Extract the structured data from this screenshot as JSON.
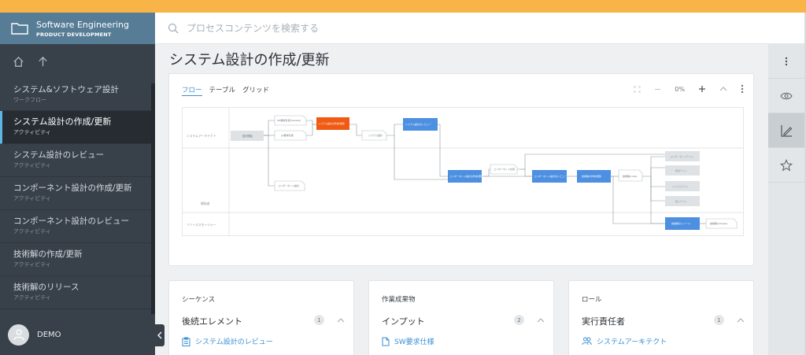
{
  "header": {
    "project_title": "Software Engineering",
    "project_subtitle": "PRODUCT DEVELOPMENT",
    "search_placeholder": "プロセスコンテンツを検索する"
  },
  "sidebar": {
    "items": [
      {
        "name": "システム&ソフトウェア設計",
        "type": "ワークフロー",
        "active": false
      },
      {
        "name": "システム設計の作成/更新",
        "type": "アクティビティ",
        "active": true
      },
      {
        "name": "システム設計のレビュー",
        "type": "アクティビティ",
        "active": false
      },
      {
        "name": "コンポーネント設計の作成/更新",
        "type": "アクティビティ",
        "active": false
      },
      {
        "name": "コンポーネント設計のレビュー",
        "type": "アクティビティ",
        "active": false
      },
      {
        "name": "技術解の作成/更新",
        "type": "アクティビティ",
        "active": false
      },
      {
        "name": "技術解のリリース",
        "type": "アクティビティ",
        "active": false
      }
    ],
    "user": "DEMO"
  },
  "page": {
    "title": "システム設計の作成/更新"
  },
  "flow_card": {
    "tabs": [
      "フロー",
      "テーブル",
      "グリッド"
    ],
    "zoom": "0%"
  },
  "diagram": {
    "lanes": [
      "システムアーキテクト",
      "開発者",
      "リリースマネージャー"
    ],
    "nodes": [
      {
        "id": "start",
        "label": "設計開始",
        "kind": "gray"
      },
      {
        "id": "d1",
        "label": "SW要求仕様(release)",
        "kind": "doc"
      },
      {
        "id": "d2",
        "label": "go要求仕様",
        "kind": "doc"
      },
      {
        "id": "a1",
        "label": "システム設計の作成/更新",
        "kind": "current"
      },
      {
        "id": "d3",
        "label": "システム設計",
        "kind": "doc"
      },
      {
        "id": "a2",
        "label": "システム設計のレビュー",
        "kind": "activity"
      },
      {
        "id": "d4",
        "label": "コンポーネント仕様",
        "kind": "doc"
      },
      {
        "id": "a3",
        "label": "コンポーネント設計の作成/更新",
        "kind": "activity"
      },
      {
        "id": "d5",
        "label": "コンポーネント設計",
        "kind": "doc"
      },
      {
        "id": "a4",
        "label": "コンポーネント設計のレビュー",
        "kind": "activity"
      },
      {
        "id": "a5",
        "label": "技術解の作成/更新",
        "kind": "activity"
      },
      {
        "id": "d6",
        "label": "技術解(code)",
        "kind": "doc"
      },
      {
        "id": "o1",
        "label": "コンポーネントテスト",
        "kind": "gray"
      },
      {
        "id": "o2",
        "label": "統合テスト",
        "kind": "gray"
      },
      {
        "id": "o3",
        "label": "システムテスト",
        "kind": "gray"
      },
      {
        "id": "o4",
        "label": "受入テスト",
        "kind": "gray"
      },
      {
        "id": "a6",
        "label": "技術解のリリース",
        "kind": "activity"
      },
      {
        "id": "d7",
        "label": "技術解(release)",
        "kind": "doc"
      }
    ]
  },
  "sections": [
    {
      "head": "シーケンス",
      "sub": "後続エレメント",
      "count": "1",
      "link": "システム設計のレビュー",
      "icon": "clipboard-icon"
    },
    {
      "head": "作業成果物",
      "sub": "インプット",
      "count": "2",
      "link": "SW要求仕様",
      "icon": "document-icon"
    },
    {
      "head": "ロール",
      "sub": "実行責任者",
      "count": "1",
      "link": "システムアーキテクト",
      "icon": "people-icon"
    }
  ],
  "colors": {
    "topbar": "#f8b446",
    "sidebar": "#38414a",
    "sidebar_header": "#577c96",
    "accent": "#3a8fd1",
    "current_activity": "#f05a12",
    "activity": "#4d8fe0"
  }
}
